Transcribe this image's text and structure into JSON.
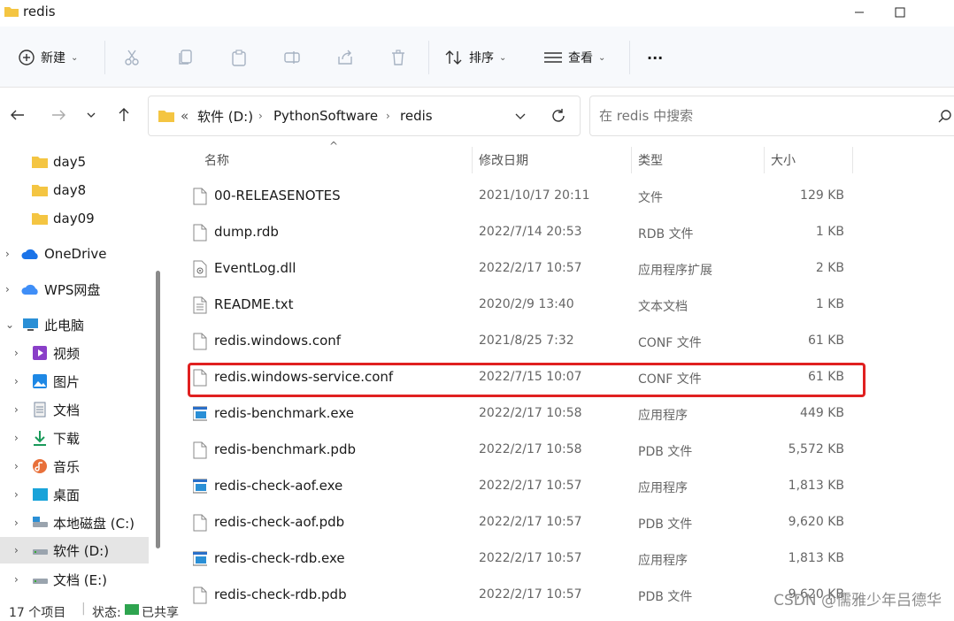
{
  "window": {
    "title": "redis"
  },
  "toolbar": {
    "new_label": "新建",
    "sort_label": "排序",
    "view_label": "查看",
    "more_label": "···"
  },
  "address": {
    "overflow": "«",
    "crumbs": [
      "软件 (D:)",
      "PythonSoftware",
      "redis"
    ]
  },
  "search": {
    "placeholder": "在 redis 中搜索"
  },
  "sidebar": {
    "items": [
      {
        "label": "day5"
      },
      {
        "label": "day8"
      },
      {
        "label": "day09"
      },
      {
        "label": "OneDrive"
      },
      {
        "label": "WPS网盘"
      },
      {
        "label": "此电脑"
      },
      {
        "label": "视频"
      },
      {
        "label": "图片"
      },
      {
        "label": "文档"
      },
      {
        "label": "下载"
      },
      {
        "label": "音乐"
      },
      {
        "label": "桌面"
      },
      {
        "label": "本地磁盘 (C:)"
      },
      {
        "label": "软件 (D:)"
      },
      {
        "label": "文档 (E:)"
      }
    ]
  },
  "columns": {
    "name": "名称",
    "modified": "修改日期",
    "type": "类型",
    "size": "大小"
  },
  "files": [
    {
      "name": "00-RELEASENOTES",
      "modified": "2021/10/17 20:11",
      "type": "文件",
      "size": "129 KB",
      "icon": "file-icon"
    },
    {
      "name": "dump.rdb",
      "modified": "2022/7/14 20:53",
      "type": "RDB 文件",
      "size": "1 KB",
      "icon": "file-icon"
    },
    {
      "name": "EventLog.dll",
      "modified": "2022/2/17 10:57",
      "type": "应用程序扩展",
      "size": "2 KB",
      "icon": "dll-icon"
    },
    {
      "name": "README.txt",
      "modified": "2020/2/9 13:40",
      "type": "文本文档",
      "size": "1 KB",
      "icon": "text-file-icon"
    },
    {
      "name": "redis.windows.conf",
      "modified": "2021/8/25 7:32",
      "type": "CONF 文件",
      "size": "61 KB",
      "icon": "file-icon"
    },
    {
      "name": "redis.windows-service.conf",
      "modified": "2022/7/15 10:07",
      "type": "CONF 文件",
      "size": "61 KB",
      "icon": "file-icon"
    },
    {
      "name": "redis-benchmark.exe",
      "modified": "2022/2/17 10:58",
      "type": "应用程序",
      "size": "449 KB",
      "icon": "exe-icon"
    },
    {
      "name": "redis-benchmark.pdb",
      "modified": "2022/2/17 10:58",
      "type": "PDB 文件",
      "size": "5,572 KB",
      "icon": "file-icon"
    },
    {
      "name": "redis-check-aof.exe",
      "modified": "2022/2/17 10:57",
      "type": "应用程序",
      "size": "1,813 KB",
      "icon": "exe-icon"
    },
    {
      "name": "redis-check-aof.pdb",
      "modified": "2022/2/17 10:57",
      "type": "PDB 文件",
      "size": "9,620 KB",
      "icon": "file-icon"
    },
    {
      "name": "redis-check-rdb.exe",
      "modified": "2022/2/17 10:57",
      "type": "应用程序",
      "size": "1,813 KB",
      "icon": "exe-icon"
    },
    {
      "name": "redis-check-rdb.pdb",
      "modified": "2022/2/17 10:57",
      "type": "PDB 文件",
      "size": "9,620 KB",
      "icon": "file-icon"
    }
  ],
  "status": {
    "count": "17 个项目",
    "state_label": "状态:",
    "state_value": "已共享"
  },
  "watermark": "CSDN @儒雅少年吕德华",
  "colors": {
    "highlight": "#e02020",
    "folder": "#f4c542",
    "selected": "#e5e5e5"
  }
}
